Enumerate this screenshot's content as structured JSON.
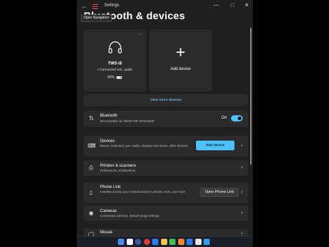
{
  "window": {
    "title": "Settings",
    "tooltip": "Open Navigation",
    "page_title": "Bluetooth & devices"
  },
  "device_card": {
    "name": "TWS-i8",
    "status": "Connected mic, audio",
    "battery_text": "80%",
    "battery_level": 0.8,
    "more_label": "..."
  },
  "add_card": {
    "plus": "+",
    "label": "Add device"
  },
  "view_more": "View more devices",
  "bluetooth": {
    "title": "Bluetooth",
    "subtitle": "Discoverable as \"DESKTOP-M7N10M4\"",
    "toggle_label": "On"
  },
  "devices": {
    "title": "Devices",
    "subtitle": "Mouse, keyboard, pen, audio, displays and docks, other devices",
    "button": "Add device"
  },
  "printers": {
    "title": "Printers & scanners",
    "subtitle": "Preferences, troubleshoot"
  },
  "phone_link": {
    "title": "Phone Link",
    "subtitle": "Instantly access your Android device's photos, texts, and more",
    "button": "Open Phone Link"
  },
  "cameras": {
    "title": "Cameras",
    "subtitle": "Connected cameras, default image settings"
  },
  "mouse": {
    "title": "Mouse"
  },
  "icons": {
    "back": "back-arrow-icon",
    "menu": "hamburger-menu-icon",
    "headphones": "headphones-icon",
    "bluetooth": "bluetooth-icon",
    "devices": "keyboard-devices-icon",
    "printer": "printer-icon",
    "phone": "phone-icon",
    "camera": "camera-icon",
    "mouse": "mouse-icon",
    "chevron": "chevron-right-icon"
  },
  "colors": {
    "accent": "#4cc2ff",
    "link": "#7fd6ff",
    "background": "#202020",
    "card": "#2b2b2b",
    "menu_highlight": "#ff4a4a"
  },
  "taskbar": {
    "app_colors": [
      "#4a8ef0",
      "#ffffff",
      "#3d5a9e",
      "#e23a3a",
      "#2b7de9",
      "#f4c542",
      "#3ac15a",
      "#f48c2b",
      "#2b7de9",
      "#e8e8e8",
      "#2e9cf0"
    ]
  }
}
